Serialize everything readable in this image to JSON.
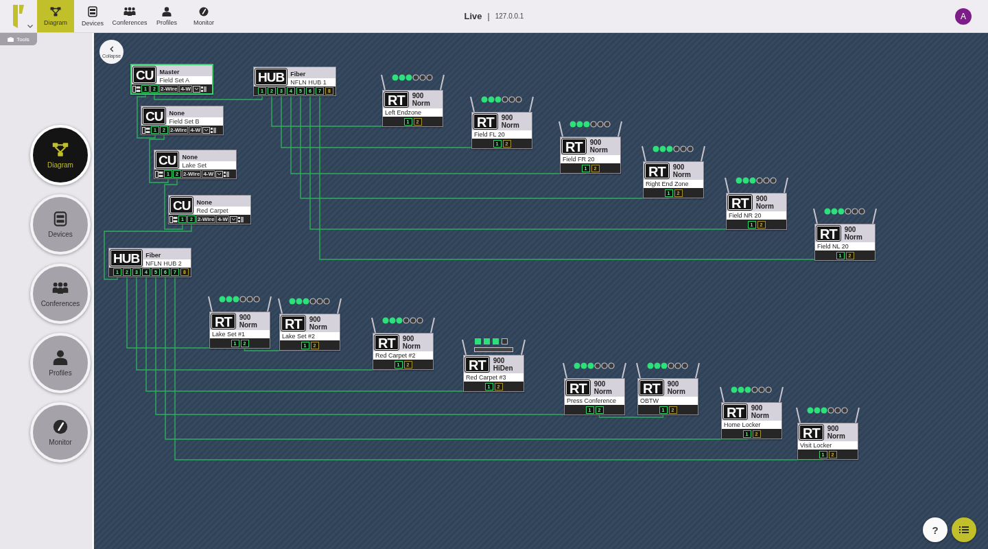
{
  "nav_tabs": [
    {
      "label": "Diagram",
      "selected": true
    },
    {
      "label": "Devices",
      "selected": false
    },
    {
      "label": "Conferences",
      "selected": false
    },
    {
      "label": "Profiles",
      "selected": false
    },
    {
      "label": "Monitor",
      "selected": false
    }
  ],
  "tools_tab": {
    "label": "Tools"
  },
  "header": {
    "mode": "Live",
    "separator": "|",
    "address": "127.0.0.1",
    "avatar": "A"
  },
  "sidebar": {
    "items": [
      {
        "label": "Diagram",
        "selected": true
      },
      {
        "label": "Devices",
        "selected": false
      },
      {
        "label": "Conferences",
        "selected": false
      },
      {
        "label": "Profiles",
        "selected": false
      },
      {
        "label": "Monitor",
        "selected": false
      }
    ]
  },
  "collapse_button": {
    "label": "Collapse"
  },
  "diagram": {
    "nodes": [
      {
        "kind": "cu",
        "badge": "CU",
        "role": "Master",
        "name": "Field Set A",
        "selected": true,
        "ports": [
          {
            "label": "1",
            "active": true
          },
          {
            "label": "2",
            "active": true
          }
        ],
        "wire_modes": [
          "2-Wire",
          "4-W"
        ]
      },
      {
        "kind": "hub",
        "badge": "HUB",
        "role": "Fiber",
        "name": "NFLN HUB 1",
        "ports": [
          {
            "label": "1",
            "active": true
          },
          {
            "label": "2",
            "active": true
          },
          {
            "label": "3",
            "active": true
          },
          {
            "label": "4",
            "active": true
          },
          {
            "label": "5",
            "active": true
          },
          {
            "label": "6",
            "active": true
          },
          {
            "label": "7",
            "active": true
          },
          {
            "label": "8",
            "active": false
          }
        ]
      },
      {
        "kind": "cu",
        "badge": "CU",
        "role": "None",
        "name": "Field Set B",
        "selected": false,
        "ports": [
          {
            "label": "1",
            "active": true
          },
          {
            "label": "2",
            "active": true
          }
        ],
        "wire_modes": [
          "2-Wire",
          "4-W"
        ]
      },
      {
        "kind": "cu",
        "badge": "CU",
        "role": "None",
        "name": "Lake Set",
        "selected": false,
        "ports": [
          {
            "label": "1",
            "active": true
          },
          {
            "label": "2",
            "active": true
          }
        ],
        "wire_modes": [
          "2-Wire",
          "4-W"
        ]
      },
      {
        "kind": "cu",
        "badge": "CU",
        "role": "None",
        "name": "Red Carpet",
        "selected": false,
        "ports": [
          {
            "label": "1",
            "active": true
          },
          {
            "label": "2",
            "active": true
          }
        ],
        "wire_modes": [
          "2-Wire",
          "4-W"
        ]
      },
      {
        "kind": "hub",
        "badge": "HUB",
        "role": "Fiber",
        "name": "NFLN HUB 2",
        "ports": [
          {
            "label": "1",
            "active": true
          },
          {
            "label": "2",
            "active": true
          },
          {
            "label": "3",
            "active": true
          },
          {
            "label": "4",
            "active": true
          },
          {
            "label": "5",
            "active": true
          },
          {
            "label": "6",
            "active": true
          },
          {
            "label": "7",
            "active": true
          },
          {
            "label": "8",
            "active": false
          }
        ]
      },
      {
        "kind": "rt",
        "badge": "RT",
        "band": "900",
        "mode": "Norm",
        "name": "Left Endzone",
        "signal": {
          "kind": "dots"
        },
        "ports": [
          {
            "label": "1",
            "active": true
          },
          {
            "label": "2",
            "active": false
          }
        ]
      },
      {
        "kind": "rt",
        "badge": "RT",
        "band": "900",
        "mode": "Norm",
        "name": "Field FL 20",
        "signal": {
          "kind": "dots"
        },
        "ports": [
          {
            "label": "1",
            "active": true
          },
          {
            "label": "2",
            "active": false
          }
        ]
      },
      {
        "kind": "rt",
        "badge": "RT",
        "band": "900",
        "mode": "Norm",
        "name": "Field FR 20",
        "signal": {
          "kind": "dots"
        },
        "ports": [
          {
            "label": "1",
            "active": true
          },
          {
            "label": "2",
            "active": false
          }
        ]
      },
      {
        "kind": "rt",
        "badge": "RT",
        "band": "900",
        "mode": "Norm",
        "name": "Right End Zone",
        "signal": {
          "kind": "dots"
        },
        "ports": [
          {
            "label": "1",
            "active": true
          },
          {
            "label": "2",
            "active": false
          }
        ]
      },
      {
        "kind": "rt",
        "badge": "RT",
        "band": "900",
        "mode": "Norm",
        "name": "Field NR 20",
        "signal": {
          "kind": "dots"
        },
        "ports": [
          {
            "label": "1",
            "active": true
          },
          {
            "label": "2",
            "active": false
          }
        ]
      },
      {
        "kind": "rt",
        "badge": "RT",
        "band": "900",
        "mode": "Norm",
        "name": "Field NL 20",
        "signal": {
          "kind": "dots"
        },
        "ports": [
          {
            "label": "1",
            "active": true
          },
          {
            "label": "2",
            "active": false
          }
        ]
      },
      {
        "kind": "rt",
        "badge": "RT",
        "band": "900",
        "mode": "Norm",
        "name": "Lake Set #1",
        "signal": {
          "kind": "dots"
        },
        "ports": [
          {
            "label": "1",
            "active": true
          },
          {
            "label": "2",
            "active": true
          }
        ]
      },
      {
        "kind": "rt",
        "badge": "RT",
        "band": "900",
        "mode": "Norm",
        "name": "Lake Set #2",
        "signal": {
          "kind": "dots"
        },
        "ports": [
          {
            "label": "1",
            "active": true
          },
          {
            "label": "2",
            "active": false
          }
        ]
      },
      {
        "kind": "rt",
        "badge": "RT",
        "band": "900",
        "mode": "Norm",
        "name": "Red Carpet #2",
        "signal": {
          "kind": "dots"
        },
        "ports": [
          {
            "label": "1",
            "active": true
          },
          {
            "label": "2",
            "active": false
          }
        ]
      },
      {
        "kind": "rt",
        "badge": "RT",
        "band": "900",
        "mode": "HiDen",
        "name": "Red Carpet #3",
        "signal": {
          "kind": "squares"
        },
        "ports": [
          {
            "label": "1",
            "active": true
          },
          {
            "label": "2",
            "active": false
          }
        ]
      },
      {
        "kind": "rt",
        "badge": "RT",
        "band": "900",
        "mode": "Norm",
        "name": "Press Conference",
        "signal": {
          "kind": "dots"
        },
        "ports": [
          {
            "label": "1",
            "active": true
          },
          {
            "label": "2",
            "active": true
          }
        ]
      },
      {
        "kind": "rt",
        "badge": "RT",
        "band": "900",
        "mode": "Norm",
        "name": "OBTW",
        "signal": {
          "kind": "dots"
        },
        "ports": [
          {
            "label": "1",
            "active": true
          },
          {
            "label": "2",
            "active": false
          }
        ]
      },
      {
        "kind": "rt",
        "badge": "RT",
        "band": "900",
        "mode": "Norm",
        "name": "Home Locker",
        "signal": {
          "kind": "dots"
        },
        "ports": [
          {
            "label": "1",
            "active": true
          },
          {
            "label": "2",
            "active": false
          }
        ]
      },
      {
        "kind": "rt",
        "badge": "RT",
        "band": "900",
        "mode": "Norm",
        "name": "Visit Locker",
        "signal": {
          "kind": "dots"
        },
        "ports": [
          {
            "label": "1",
            "active": true
          },
          {
            "label": "2",
            "active": false
          }
        ]
      }
    ]
  },
  "help_button": {
    "label": "?"
  }
}
